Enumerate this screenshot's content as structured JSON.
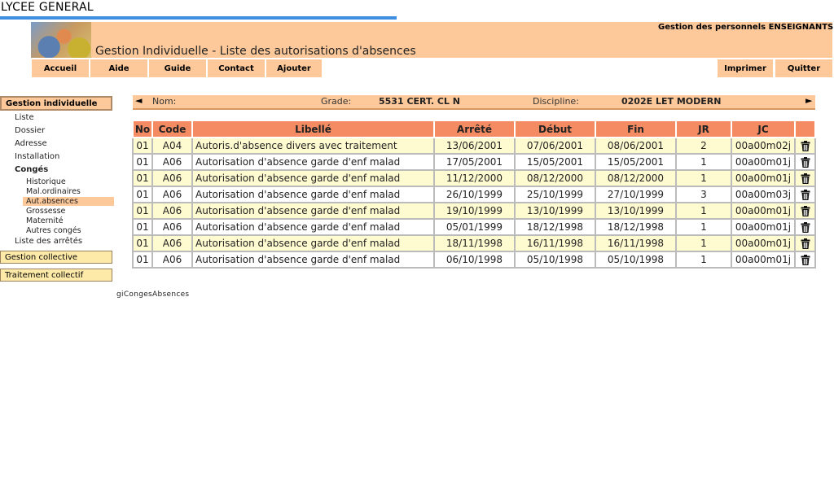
{
  "site": {
    "title": "LYCEE GENERAL"
  },
  "header": {
    "subtitle": "Gestion des personnels ENSEIGNANTS",
    "heading": "Gestion Individuelle - Liste des autorisations d'absences"
  },
  "nav": {
    "accueil": "Accueil",
    "aide": "Aide",
    "guide": "Guide",
    "contact": "Contact",
    "ajouter": "Ajouter",
    "imprimer": "Imprimer",
    "quitter": "Quitter"
  },
  "sidebar": {
    "gestion_individuelle": "Gestion individuelle",
    "liste": "Liste",
    "dossier": "Dossier",
    "adresse": "Adresse",
    "installation": "Installation",
    "conges": "Congés",
    "historique": "Historique",
    "mal_ordinaires": "Mal.ordinaires",
    "aut_absences": "Aut.absences",
    "grossesse": "Grossesse",
    "maternite": "Maternité",
    "autres_conges": "Autres congés",
    "liste_arretes": "Liste des arrêtés",
    "gestion_collective": "Gestion collective",
    "traitement_collectif": "Traitement collectif"
  },
  "info": {
    "nom_label": "Nom:",
    "nom_value": "",
    "grade_label": "Grade:",
    "grade_value": "5531 CERT. CL N",
    "discipline_label": "Discipline:",
    "discipline_value": "0202E LET MODERN"
  },
  "table": {
    "headers": [
      "No",
      "Code",
      "Libellé",
      "Arrêté",
      "Début",
      "Fin",
      "JR",
      "JC"
    ],
    "rows": [
      [
        "01",
        "A04",
        "Autoris.d'absence divers avec traitement",
        "13/06/2001",
        "07/06/2001",
        "08/06/2001",
        "2",
        "00a00m02j"
      ],
      [
        "01",
        "A06",
        "Autorisation d'absence garde d'enf malad",
        "17/05/2001",
        "15/05/2001",
        "15/05/2001",
        "1",
        "00a00m01j"
      ],
      [
        "01",
        "A06",
        "Autorisation d'absence garde d'enf malad",
        "11/12/2000",
        "08/12/2000",
        "08/12/2000",
        "1",
        "00a00m01j"
      ],
      [
        "01",
        "A06",
        "Autorisation d'absence garde d'enf malad",
        "26/10/1999",
        "25/10/1999",
        "27/10/1999",
        "3",
        "00a00m03j"
      ],
      [
        "01",
        "A06",
        "Autorisation d'absence garde d'enf malad",
        "19/10/1999",
        "13/10/1999",
        "13/10/1999",
        "1",
        "00a00m01j"
      ],
      [
        "01",
        "A06",
        "Autorisation d'absence garde d'enf malad",
        "05/01/1999",
        "18/12/1998",
        "18/12/1998",
        "1",
        "00a00m01j"
      ],
      [
        "01",
        "A06",
        "Autorisation d'absence garde d'enf malad",
        "18/11/1998",
        "16/11/1998",
        "16/11/1998",
        "1",
        "00a00m01j"
      ],
      [
        "01",
        "A06",
        "Autorisation d'absence garde d'enf malad",
        "06/10/1998",
        "05/10/1998",
        "05/10/1998",
        "1",
        "00a00m01j"
      ]
    ]
  },
  "footer": {
    "code": "giCongesAbsences"
  },
  "colors": {
    "accent": "#3f8fe0",
    "band": "#fdc99a",
    "table_header": "#f48b62",
    "row_highlight": "#fffbd0"
  },
  "icons": {
    "delete": "trash-icon",
    "prev": "arrow-left-icon",
    "next": "arrow-right-icon"
  }
}
